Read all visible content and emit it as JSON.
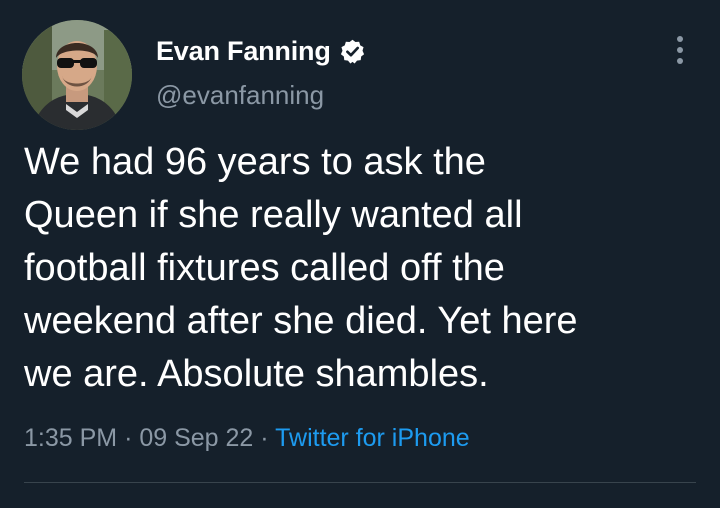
{
  "author": {
    "display_name": "Evan Fanning",
    "handle": "@evanfanning",
    "verified": true,
    "avatar_icon": "avatar-photo"
  },
  "tweet": {
    "text": "We had 96 years to ask the\nQueen if she really wanted all\nfootball fixtures called off the\nweekend after she died. Yet here\nwe are. Absolute shambles.",
    "time": "1:35 PM",
    "date": "09 Sep 22",
    "separator": "·",
    "source": "Twitter for iPhone"
  },
  "icons": {
    "verified": "verified-badge-icon",
    "more": "more-options-icon"
  },
  "colors": {
    "background": "#15202b",
    "text": "#ffffff",
    "secondary": "#8b98a5",
    "accent": "#1d9bf0",
    "divider": "#38444d"
  }
}
